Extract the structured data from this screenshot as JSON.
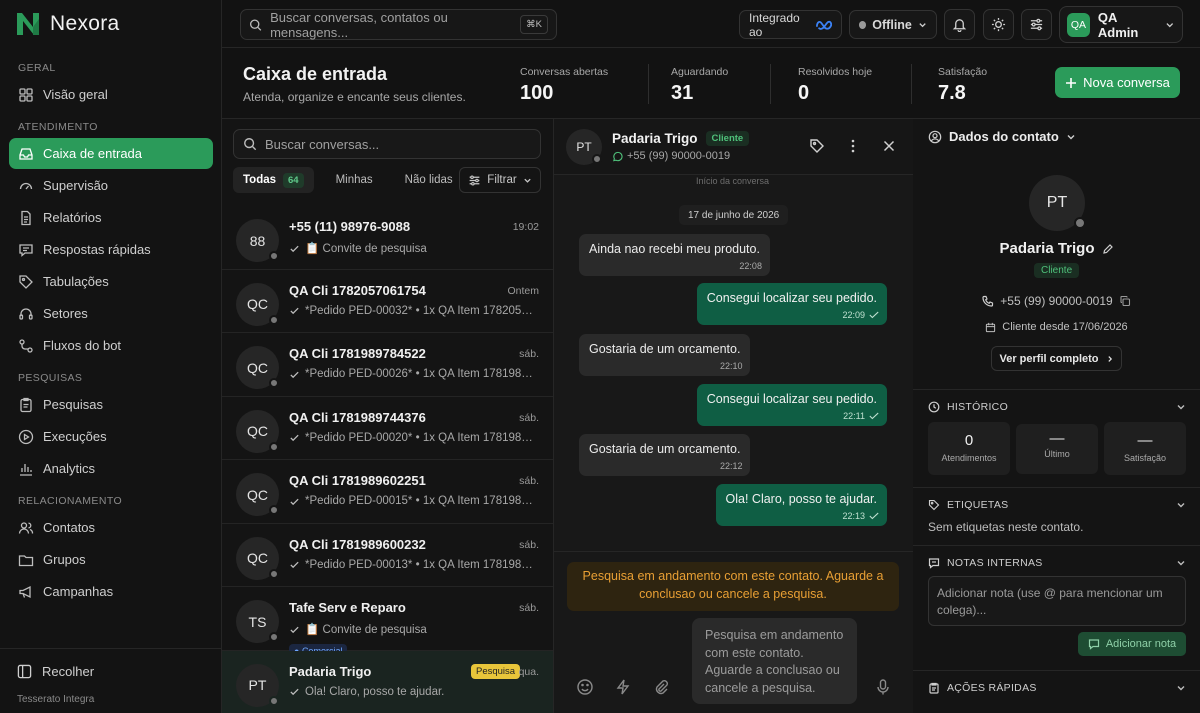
{
  "app": {
    "name": "Nexora"
  },
  "sidebar": {
    "sections": [
      {
        "title": "GERAL",
        "items": [
          {
            "label": "Visão geral",
            "icon": "grid-icon"
          }
        ]
      },
      {
        "title": "ATENDIMENTO",
        "items": [
          {
            "label": "Caixa de entrada",
            "icon": "inbox-icon",
            "active": true
          },
          {
            "label": "Supervisão",
            "icon": "gauge-icon"
          },
          {
            "label": "Relatórios",
            "icon": "document-icon"
          },
          {
            "label": "Respostas rápidas",
            "icon": "message-icon"
          },
          {
            "label": "Tabulações",
            "icon": "tag-icon"
          },
          {
            "label": "Setores",
            "icon": "headset-icon"
          },
          {
            "label": "Fluxos do bot",
            "icon": "flow-icon"
          }
        ]
      },
      {
        "title": "PESQUISAS",
        "items": [
          {
            "label": "Pesquisas",
            "icon": "clipboard-icon"
          },
          {
            "label": "Execuções",
            "icon": "play-icon"
          },
          {
            "label": "Analytics",
            "icon": "chart-icon"
          }
        ]
      },
      {
        "title": "RELACIONAMENTO",
        "items": [
          {
            "label": "Contatos",
            "icon": "users-icon"
          },
          {
            "label": "Grupos",
            "icon": "folder-icon"
          },
          {
            "label": "Campanhas",
            "icon": "megaphone-icon"
          }
        ]
      }
    ],
    "collapse_label": "Recolher",
    "footer": "Tesserato Integra"
  },
  "topbar": {
    "search_placeholder": "Buscar conversas, contatos ou mensagens...",
    "search_shortcut": "⌘K",
    "integration_label": "Integrado ao",
    "status_label": "Offline",
    "user_initials": "QA",
    "user_name": "QA Admin"
  },
  "header": {
    "title": "Caixa de entrada",
    "subtitle": "Atenda, organize e encante seus clientes.",
    "stats": [
      {
        "label": "Conversas abertas",
        "value": "100"
      },
      {
        "label": "Aguardando",
        "value": "31"
      },
      {
        "label": "Resolvidos hoje",
        "value": "0"
      },
      {
        "label": "Satisfação",
        "value": "7.8"
      }
    ],
    "new_button": "Nova conversa"
  },
  "conversations": {
    "search_placeholder": "Buscar conversas...",
    "tabs": [
      {
        "label": "Todas",
        "count": "64"
      },
      {
        "label": "Minhas"
      },
      {
        "label": "Não lidas"
      }
    ],
    "filter_label": "Filtrar",
    "items": [
      {
        "initials": "88",
        "name": "+55 (11) 98976-9088",
        "time": "19:02",
        "preview": "📋 Convite de pesquisa"
      },
      {
        "initials": "QC",
        "name": "QA Cli 1782057061754",
        "time": "Ontem",
        "preview": "*Pedido PED-00032* • 1x QA Item 1782057061754"
      },
      {
        "initials": "QC",
        "name": "QA Cli 1781989784522",
        "time": "sáb.",
        "preview": "*Pedido PED-00026* • 1x QA Item 1781989784522"
      },
      {
        "initials": "QC",
        "name": "QA Cli 1781989744376",
        "time": "sáb.",
        "preview": "*Pedido PED-00020* • 1x QA Item 1781989744376"
      },
      {
        "initials": "QC",
        "name": "QA Cli 1781989602251",
        "time": "sáb.",
        "preview": "*Pedido PED-00015* • 1x QA Item 1781989602251"
      },
      {
        "initials": "QC",
        "name": "QA Cli 1781989600232",
        "time": "sáb.",
        "preview": "*Pedido PED-00013* • 1x QA Item 1781989600232"
      },
      {
        "initials": "TS",
        "name": "Tafe Serv e Reparo",
        "time": "sáb.",
        "preview": "📋 Convite de pesquisa",
        "tag": "Comercial"
      },
      {
        "initials": "PT",
        "name": "Padaria Trigo",
        "time": "qua.",
        "preview": "Ola! Claro, posso te ajudar.",
        "badge": "Pesquisa",
        "selected": true
      }
    ]
  },
  "chat": {
    "initials": "PT",
    "name": "Padaria Trigo",
    "badge": "Cliente",
    "phone": "+55 (99) 90000-0019",
    "faded_top": "Início da conversa",
    "day_separator": "17 de junho de 2026",
    "messages": [
      {
        "dir": "in",
        "text": "Ainda nao recebi meu produto.",
        "time": "22:08"
      },
      {
        "dir": "out",
        "text": "Consegui localizar seu pedido.",
        "time": "22:09"
      },
      {
        "dir": "in",
        "text": "Gostaria de um orcamento.",
        "time": "22:10"
      },
      {
        "dir": "out",
        "text": "Consegui localizar seu pedido.",
        "time": "22:11"
      },
      {
        "dir": "in",
        "text": "Gostaria de um orcamento.",
        "time": "22:12"
      },
      {
        "dir": "out",
        "text": "Ola! Claro, posso te ajudar.",
        "time": "22:13"
      }
    ],
    "warning": "Pesquisa em andamento com este contato. Aguarde a conclusao ou cancele a pesquisa.",
    "composer_placeholder": "Pesquisa em andamento com este contato. Aguarde a conclusao ou cancele a pesquisa."
  },
  "contact": {
    "header": "Dados do contato",
    "initials": "PT",
    "name": "Padaria Trigo",
    "badge": "Cliente",
    "phone": "+55 (99) 90000-0019",
    "since": "Cliente desde 17/06/2026",
    "profile_button": "Ver perfil completo",
    "history_title": "HISTÓRICO",
    "history": [
      {
        "value": "0",
        "label": "Atendimentos"
      },
      {
        "value": "—",
        "label": "Último"
      },
      {
        "value": "—",
        "label": "Satisfação"
      }
    ],
    "tags_title": "ETIQUETAS",
    "tags_empty": "Sem etiquetas neste contato.",
    "notes_title": "NOTAS INTERNAS",
    "notes_placeholder": "Adicionar nota (use @ para mencionar um colega)...",
    "add_note_button": "Adicionar nota",
    "quick_actions_title": "AÇÕES RÁPIDAS"
  },
  "colors": {
    "accent": "#2b9b5a",
    "outgoing_bubble": "#0f5e44",
    "warning": "#e89f34"
  }
}
